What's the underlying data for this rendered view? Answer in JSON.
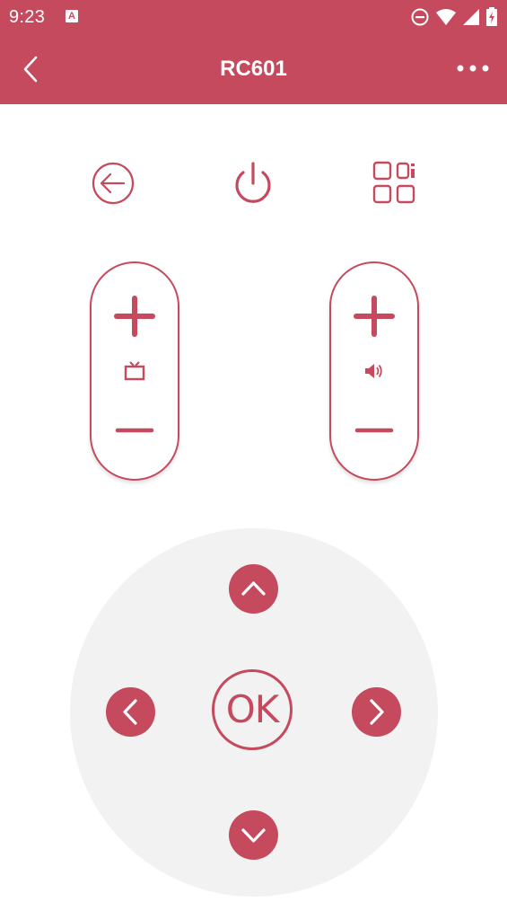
{
  "status_bar": {
    "time": "9:23",
    "notification_icon": "a-notification-icon",
    "icons": [
      "do-not-disturb-icon",
      "wifi-icon",
      "signal-icon",
      "battery-icon"
    ]
  },
  "app_bar": {
    "title": "RC601",
    "back_icon": "chevron-left-icon",
    "more_icon": "more-horizontal-icon"
  },
  "top_controls": {
    "return_icon": "back-arrow-circle-icon",
    "power_icon": "power-icon",
    "menu_icon": "apps-grid-icon"
  },
  "channel_control": {
    "up_icon": "plus-icon",
    "center_icon": "tv-icon",
    "down_icon": "minus-icon"
  },
  "volume_control": {
    "up_icon": "plus-icon",
    "center_icon": "speaker-icon",
    "down_icon": "minus-icon"
  },
  "dpad": {
    "ok_label": "OK",
    "up_icon": "chevron-up-icon",
    "down_icon": "chevron-down-icon",
    "left_icon": "chevron-left-icon",
    "right_icon": "chevron-right-icon"
  },
  "colors": {
    "accent": "#c54a5d",
    "dpad_background": "#f2f2f2",
    "background": "#ffffff"
  }
}
